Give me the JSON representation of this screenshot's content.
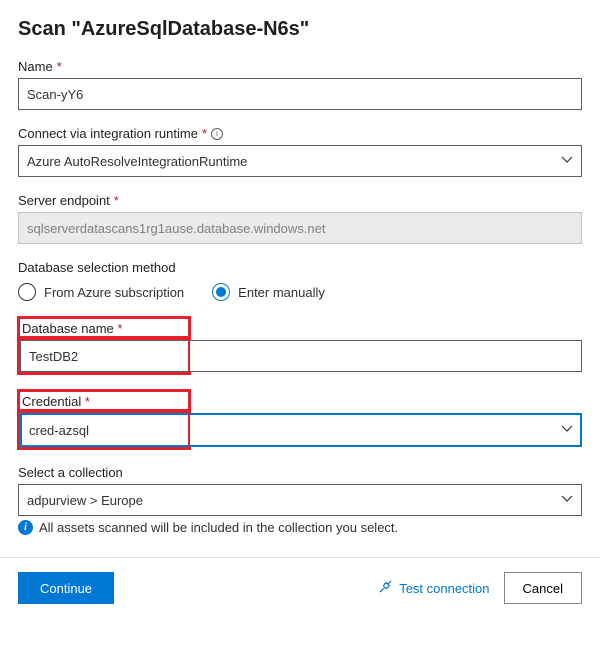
{
  "title": "Scan \"AzureSqlDatabase-N6s\"",
  "name": {
    "label": "Name",
    "value": "Scan-yY6"
  },
  "runtime": {
    "label": "Connect via integration runtime",
    "value": "Azure AutoResolveIntegrationRuntime"
  },
  "endpoint": {
    "label": "Server endpoint",
    "value": "sqlserverdatascans1rg1ause.database.windows.net"
  },
  "dbmethod": {
    "label": "Database selection method",
    "options": [
      "From Azure subscription",
      "Enter manually"
    ],
    "selected": 1
  },
  "dbname": {
    "label": "Database name",
    "value": "TestDB2"
  },
  "credential": {
    "label": "Credential",
    "value": "cred-azsql"
  },
  "collection": {
    "label": "Select a collection",
    "value": "adpurview > Europe",
    "hint": "All assets scanned will be included in the collection you select."
  },
  "footer": {
    "continue": "Continue",
    "test": "Test connection",
    "cancel": "Cancel"
  }
}
